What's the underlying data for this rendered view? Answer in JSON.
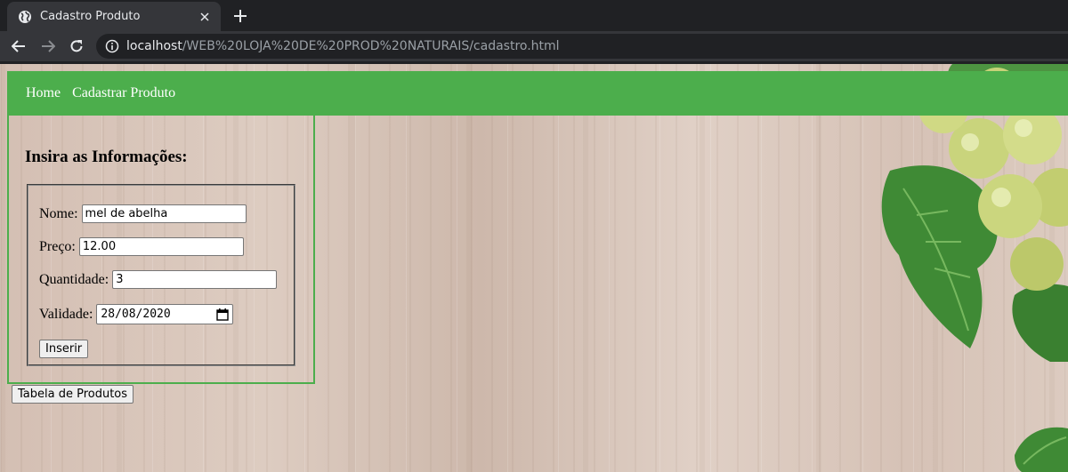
{
  "browser": {
    "tab_title": "Cadastro Produto",
    "url_host": "localhost",
    "url_path": "/WEB%20LOJA%20DE%20PROD%20NATURAIS/cadastro.html"
  },
  "nav": {
    "items": [
      {
        "label": "Home"
      },
      {
        "label": "Cadastrar Produto"
      }
    ]
  },
  "form": {
    "heading": "Insira as Informações:",
    "nome": {
      "label": "Nome:",
      "value": "mel de abelha"
    },
    "preco": {
      "label": "Preço:",
      "value": "12.00"
    },
    "quantidade": {
      "label": "Quantidade:",
      "value": "3"
    },
    "validade": {
      "label": "Validade:",
      "value": "28/08/2020"
    },
    "submit_label": "Inserir"
  },
  "table_button_label": "Tabela de Produtos",
  "colors": {
    "menu_green": "#4cae4c",
    "chrome_dark": "#202124",
    "chrome_toolbar": "#35363a"
  }
}
